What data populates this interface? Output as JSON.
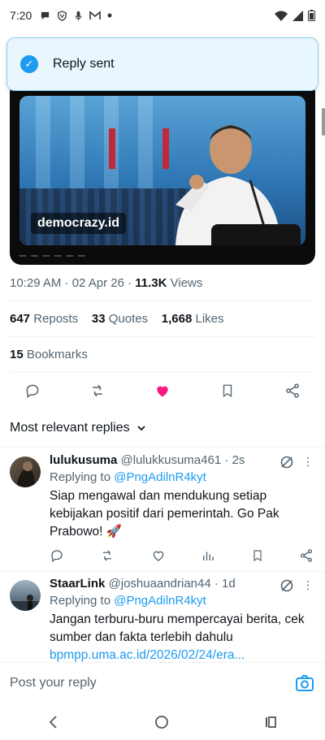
{
  "status_bar": {
    "time": "7:20",
    "notification_icons": [
      "chat-bubble-icon",
      "shield-v-icon",
      "mic-icon",
      "gmail-icon",
      "dot-icon"
    ],
    "system_icons": [
      "wifi-icon",
      "signal-icon",
      "battery-icon"
    ]
  },
  "toast": {
    "message": "Reply sent"
  },
  "media": {
    "watermark": "democrazy.id"
  },
  "tweet_meta": {
    "timestamp": "10:29 AM · 02 Apr 26 · ",
    "views_count": "11.3K",
    "views_label": " Views"
  },
  "stats": {
    "reposts_count": "647",
    "reposts_label": " Reposts",
    "quotes_count": "33",
    "quotes_label": " Quotes",
    "likes_count": "1,668",
    "likes_label": " Likes",
    "bookmarks_count": "15",
    "bookmarks_label": " Bookmarks"
  },
  "sort": {
    "label": "Most relevant replies"
  },
  "replies": [
    {
      "name": "lulukusuma",
      "handle": "@lulukkusuma461",
      "time": " · 2s",
      "replying_prefix": "Replying to ",
      "replying_to": "@PngAdilnR4kyt",
      "text": "Siap mengawal dan mendukung setiap kebijakan positif dari pemerintah. Go Pak Prabowo! 🚀",
      "link": ""
    },
    {
      "name": "StaarLink",
      "handle": "@joshuaandrian44",
      "time": " · 1d",
      "replying_prefix": "Replying to ",
      "replying_to": "@PngAdilnR4kyt",
      "text": "Jangan terburu-buru mempercayai berita, cek sumber dan fakta terlebih dahulu",
      "link": "bpmpp.uma.ac.id/2026/02/24/era..."
    }
  ],
  "composer": {
    "placeholder": "Post your reply"
  },
  "colors": {
    "accent": "#1d9bf0",
    "like": "#f91880",
    "text": "#0f1419",
    "muted": "#536471"
  }
}
